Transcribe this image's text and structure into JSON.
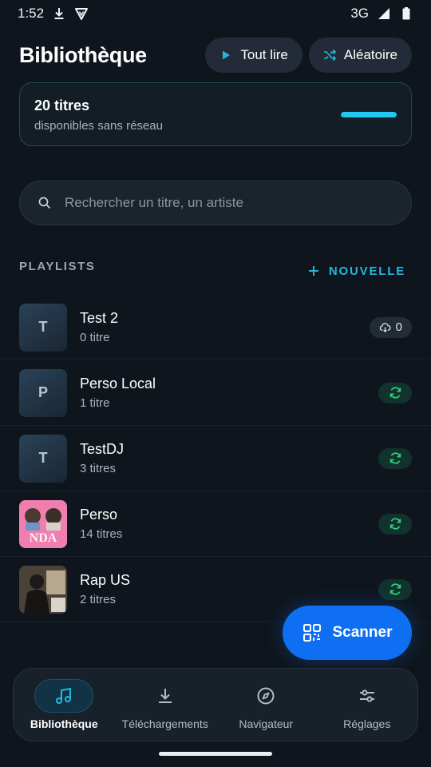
{
  "status_bar": {
    "time": "1:52",
    "network": "3G"
  },
  "header": {
    "title": "Bibliothèque",
    "play_all_label": "Tout lire",
    "shuffle_label": "Aléatoire"
  },
  "offline": {
    "count_label": "20 titres",
    "subtitle": "disponibles sans réseau",
    "progress": 1.0,
    "accent_color": "#1ec8f0"
  },
  "search": {
    "placeholder": "Rechercher un titre, un artiste"
  },
  "playlists_section": {
    "title": "PLAYLISTS",
    "new_label": "NOUVELLE"
  },
  "playlists": [
    {
      "name": "Test 2",
      "count": "0 titre",
      "initial": "T",
      "badge": "cloud",
      "badge_value": "0"
    },
    {
      "name": "Perso Local",
      "count": "1 titre",
      "initial": "P",
      "badge": "sync"
    },
    {
      "name": "TestDJ",
      "count": "3 titres",
      "initial": "T",
      "badge": "sync"
    },
    {
      "name": "Perso",
      "count": "14 titres",
      "cover": "artwork-pink",
      "badge": "sync"
    },
    {
      "name": "Rap US",
      "count": "2 titres",
      "cover": "artwork-photo",
      "badge": "sync"
    }
  ],
  "fab": {
    "label": "Scanner",
    "color": "#0f6ff2"
  },
  "nav": {
    "items": [
      {
        "label": "Bibliothèque",
        "icon": "music-note-icon",
        "active": true
      },
      {
        "label": "Téléchargements",
        "icon": "download-icon",
        "active": false
      },
      {
        "label": "Navigateur",
        "icon": "compass-icon",
        "active": false
      },
      {
        "label": "Réglages",
        "icon": "sliders-icon",
        "active": false
      }
    ]
  }
}
